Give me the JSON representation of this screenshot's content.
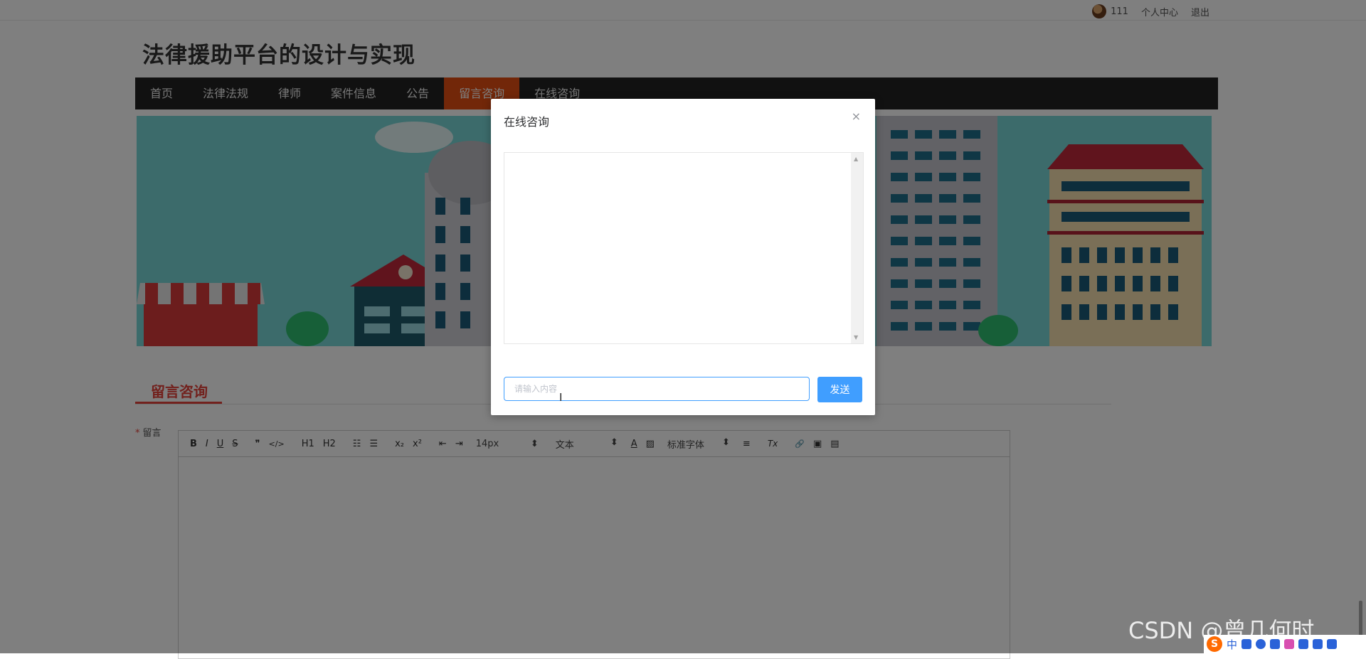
{
  "topbar": {
    "username": "111",
    "personal_center": "个人中心",
    "logout": "退出"
  },
  "site": {
    "title": "法律援助平台的设计与实现"
  },
  "nav": {
    "items": [
      {
        "label": "首页"
      },
      {
        "label": "法律法规"
      },
      {
        "label": "律师"
      },
      {
        "label": "案件信息"
      },
      {
        "label": "公告"
      },
      {
        "label": "留言咨询",
        "active": true
      },
      {
        "label": "在线咨询"
      }
    ]
  },
  "section": {
    "title": "留言咨询"
  },
  "form": {
    "message_label": "留言",
    "required_mark": "*",
    "toolbar": {
      "bold": "B",
      "italic": "I",
      "underline": "U",
      "strike": "S",
      "quote": "❞",
      "code": "</>",
      "h1": "H1",
      "h2": "H2",
      "ordered_list": "☷",
      "bullet_list": "☰",
      "subscript": "x₂",
      "superscript": "x²",
      "outdent": "⇤",
      "indent": "⇥",
      "font_size": "14px",
      "header_type": "文本",
      "font_family": "标准字体",
      "font_color": "A",
      "bg_color": "▨",
      "align": "≡",
      "clean": "Tx",
      "link": "🔗",
      "image": "▣",
      "video": "▤"
    }
  },
  "modal": {
    "title": "在线咨询",
    "close": "×",
    "input_placeholder": "请输入内容",
    "send_label": "发送"
  },
  "watermark": {
    "text": "CSDN @曾几何时…"
  },
  "tray": {
    "ime_logo": "S",
    "ime_lang": "中",
    "others": "•"
  },
  "colors": {
    "accent": "#e44e12",
    "primary": "#409eff",
    "section_red": "#e4423a",
    "nav_bg": "#222222"
  }
}
